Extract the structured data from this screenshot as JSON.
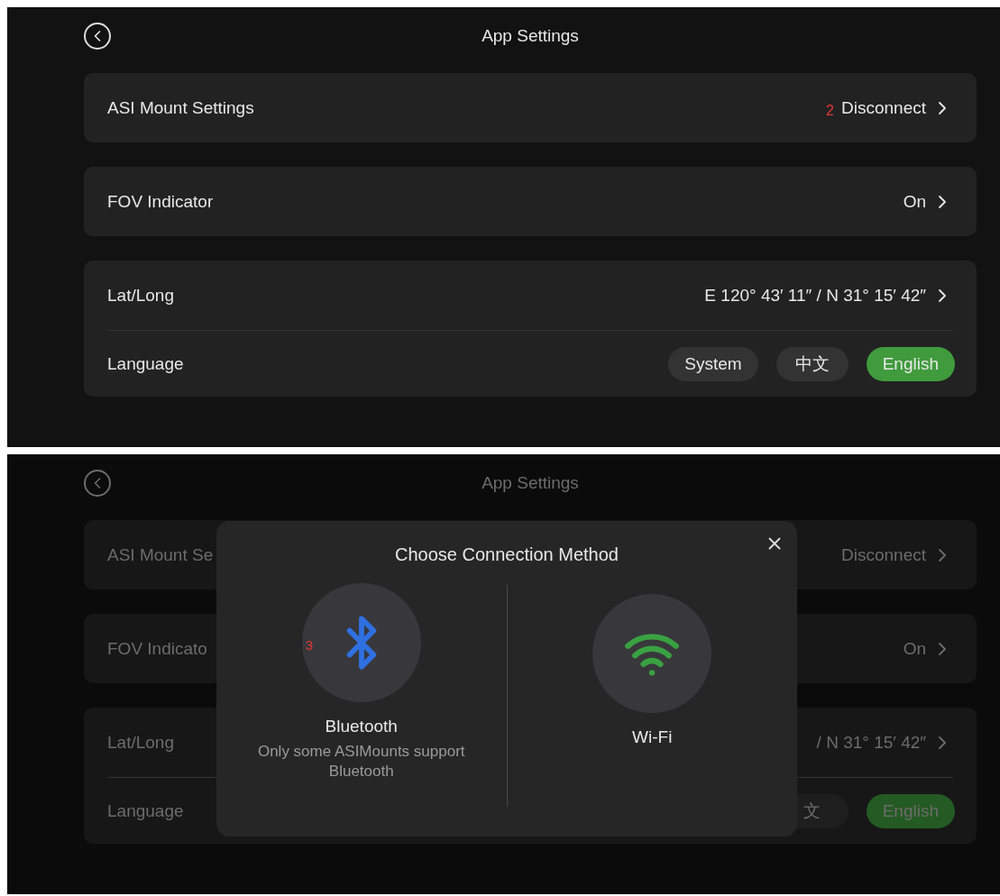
{
  "screens": [
    {
      "title": "App Settings",
      "dimmed": false,
      "groups": [
        {
          "rows": [
            {
              "kind": "link",
              "label": "ASI Mount Settings",
              "badge": "2",
              "value": "Disconnect"
            }
          ]
        },
        {
          "rows": [
            {
              "kind": "link",
              "label": "FOV Indicator",
              "value": "On"
            }
          ]
        },
        {
          "rows": [
            {
              "kind": "link",
              "label": "Lat/Long",
              "value": "E 120° 43′ 11″ / N 31° 15′ 42″"
            },
            {
              "kind": "choice",
              "label": "Language",
              "options": [
                {
                  "label": "System",
                  "selected": false
                },
                {
                  "label": "中文",
                  "selected": false
                },
                {
                  "label": "English",
                  "selected": true
                }
              ]
            }
          ]
        }
      ]
    },
    {
      "title": "App Settings",
      "dimmed": true,
      "groups": [
        {
          "rows": [
            {
              "kind": "link",
              "label": "ASI Mount Se",
              "value": "Disconnect"
            }
          ]
        },
        {
          "rows": [
            {
              "kind": "link",
              "label": "FOV Indicato",
              "value": "On"
            }
          ]
        },
        {
          "rows": [
            {
              "kind": "link",
              "label": "Lat/Long",
              "value": "/ N 31° 15′ 42″"
            },
            {
              "kind": "choice",
              "label": "Language",
              "options": [
                {
                  "label": "文",
                  "selected": false
                },
                {
                  "label": "English",
                  "selected": true
                }
              ]
            }
          ]
        }
      ],
      "dialog": {
        "title": "Choose Connection Method",
        "options": [
          {
            "kind": "bluetooth",
            "label": "Bluetooth",
            "badge": "3",
            "note": "Only some ASIMounts support Bluetooth"
          },
          {
            "kind": "wifi",
            "label": "Wi-Fi"
          }
        ]
      }
    }
  ]
}
